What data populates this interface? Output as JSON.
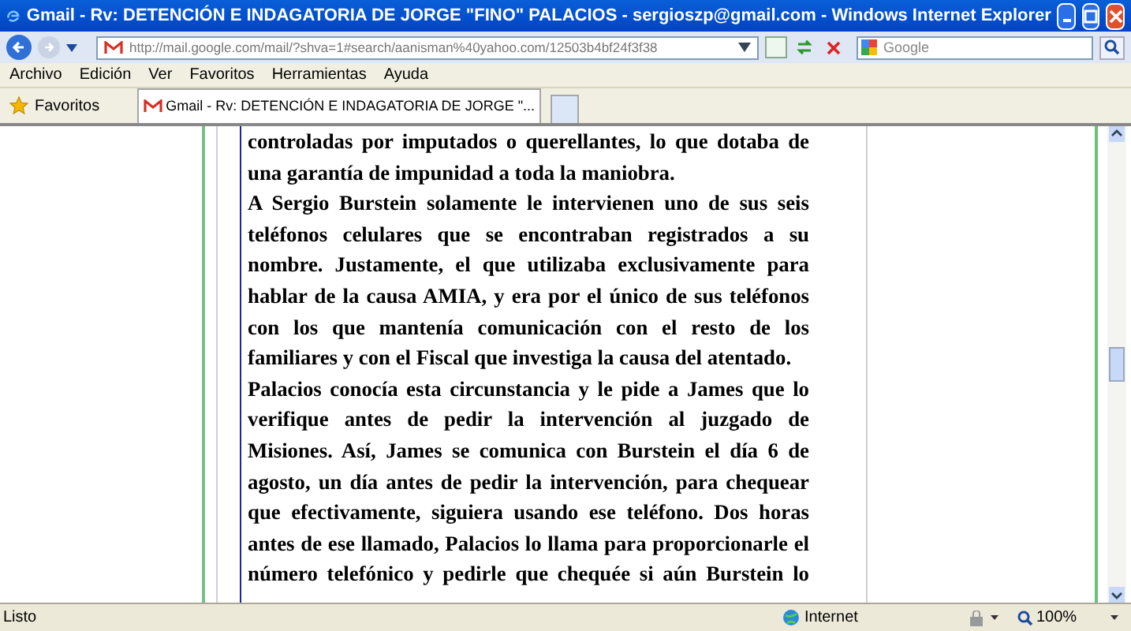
{
  "window": {
    "title": "Gmail - Rv: DETENCIÓN E INDAGATORIA DE JORGE \"FINO\" PALACIOS - sergioszp@gmail.com - Windows Internet Explorer"
  },
  "address_bar": {
    "url": "http://mail.google.com/mail/?shva=1#search/aanisman%40yahoo.com/12503b4bf24f3f38",
    "search_placeholder": "Google"
  },
  "menu": [
    "Archivo",
    "Edición",
    "Ver",
    "Favoritos",
    "Herramientas",
    "Ayuda"
  ],
  "favorites_button": "Favoritos",
  "tabs": [
    {
      "label": "Gmail - Rv: DETENCIÓN E INDAGATORIA DE JORGE \"...",
      "selected": true
    }
  ],
  "paragraphs": [
    {
      "lines": [
        "controladas por imputados o querellantes, lo que dotaba de",
        "una garantía de impunidad a toda la maniobra."
      ]
    },
    {
      "lines": [
        "A Sergio Burstein solamente le intervienen uno de sus seis",
        "teléfonos celulares que se encontraban registrados a su",
        "nombre. Justamente, el que utilizaba exclusivamente para",
        "hablar de la causa AMIA, y era por el único de sus teléfonos",
        "con los que mantenía comunicación con el resto de los",
        "familiares y con el Fiscal que investiga la causa del atentado."
      ]
    },
    {
      "lines": [
        "Palacios conocía esta circunstancia y le pide a James que lo",
        "verifique antes de pedir la intervención al juzgado de",
        "Misiones. Así, James se comunica con Burstein el día 6 de",
        "agosto, un día antes de pedir la intervención, para chequear",
        "que efectivamente, siguiera usando ese teléfono. Dos horas",
        "antes de ese llamado, Palacios lo llama para proporcionarle el",
        "número telefónico y pedirle que chequée si aún Burstein lo"
      ]
    }
  ],
  "status_bar": {
    "status": "Listo",
    "zone": "Internet",
    "zoom": "100%"
  }
}
